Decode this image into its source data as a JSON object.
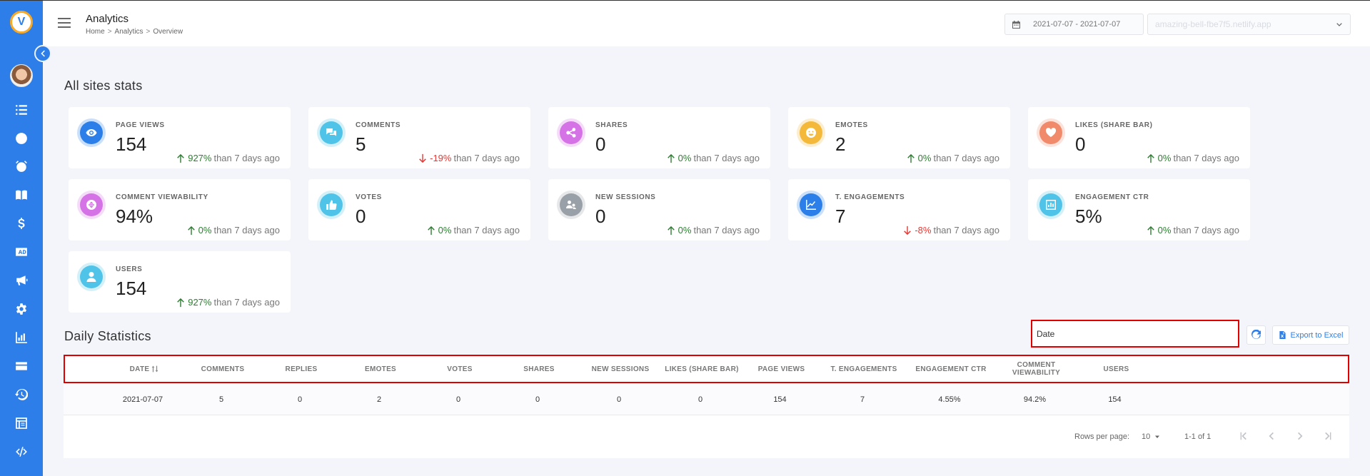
{
  "header": {
    "title": "Analytics",
    "breadcrumb": [
      "Home",
      "Analytics",
      "Overview"
    ],
    "date_range": "2021-07-07 - 2021-07-07",
    "site": "amazing-bell-fbe7f5.netlify.app"
  },
  "sidebar": {
    "logo_letter": "V",
    "icons": [
      "list-icon",
      "clock-icon",
      "alarm-icon",
      "book-icon",
      "dollar-icon",
      "ad-icon",
      "megaphone-icon",
      "gear-icon",
      "chart-icon",
      "card-icon",
      "history-icon",
      "table-icon",
      "code-icon"
    ]
  },
  "all_sites": {
    "title": "All sites stats",
    "trend_suffix": "than 7 days ago",
    "cards": [
      {
        "label": "PAGE VIEWS",
        "value": "154",
        "pct": "927%",
        "dir": "up",
        "icon": "eye-icon",
        "color": "#2d7ee8"
      },
      {
        "label": "COMMENTS",
        "value": "5",
        "pct": "-19%",
        "dir": "down",
        "icon": "comments-icon",
        "color": "#4fc3e8"
      },
      {
        "label": "SHARES",
        "value": "0",
        "pct": "0%",
        "dir": "up",
        "icon": "share-icon",
        "color": "#d572e6"
      },
      {
        "label": "EMOTES",
        "value": "2",
        "pct": "0%",
        "dir": "up",
        "icon": "smile-icon",
        "color": "#f5b93a"
      },
      {
        "label": "LIKES (SHARE BAR)",
        "value": "0",
        "pct": "0%",
        "dir": "up",
        "icon": "heart-icon",
        "color": "#f08a6a"
      },
      {
        "label": "COMMENT VIEWABILITY",
        "value": "94%",
        "pct": "0%",
        "dir": "up",
        "icon": "viewability-icon",
        "color": "#d572e6"
      },
      {
        "label": "VOTES",
        "value": "0",
        "pct": "0%",
        "dir": "up",
        "icon": "thumbs-up-icon",
        "color": "#4fc3e8"
      },
      {
        "label": "NEW SESSIONS",
        "value": "0",
        "pct": "0%",
        "dir": "up",
        "icon": "sessions-icon",
        "color": "#9aa0a8"
      },
      {
        "label": "T. ENGAGEMENTS",
        "value": "7",
        "pct": "-8%",
        "dir": "down",
        "icon": "engagement-chart-icon",
        "color": "#2d7ee8"
      },
      {
        "label": "ENGAGEMENT CTR",
        "value": "5%",
        "pct": "0%",
        "dir": "up",
        "icon": "bar-chart-icon",
        "color": "#4fc3e8"
      },
      {
        "label": "USERS",
        "value": "154",
        "pct": "927%",
        "dir": "up",
        "icon": "user-icon",
        "color": "#4fc3e8"
      }
    ]
  },
  "daily": {
    "title": "Daily Statistics",
    "filter_value": "Date",
    "export_label": "Export to Excel",
    "columns": [
      "DATE",
      "COMMENTS",
      "REPLIES",
      "EMOTES",
      "VOTES",
      "SHARES",
      "NEW SESSIONS",
      "LIKES (SHARE BAR)",
      "PAGE VIEWS",
      "T. ENGAGEMENTS",
      "ENGAGEMENT CTR",
      "COMMENT VIEWABILITY",
      "USERS"
    ],
    "rows": [
      [
        "2021-07-07",
        "5",
        "0",
        "2",
        "0",
        "0",
        "0",
        "0",
        "154",
        "7",
        "4.55%",
        "94.2%",
        "154"
      ]
    ],
    "rows_per_page_label": "Rows per page:",
    "rows_per_page": "10",
    "range_text": "1-1 of 1"
  }
}
